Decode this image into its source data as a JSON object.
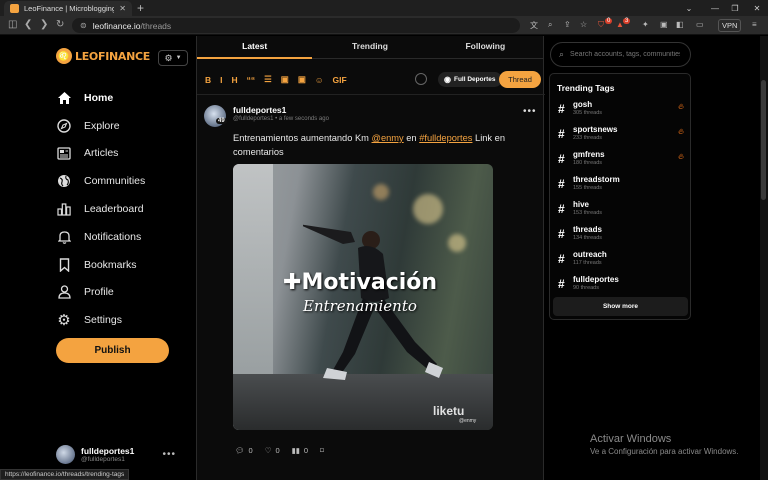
{
  "browser": {
    "tab_title": "LeoFinance | Microblogging in Bl...",
    "url_host": "leofinance.io",
    "url_path": "/threads",
    "vpn_label": "VPN",
    "badge_count_1": "0",
    "badge_count_2": "3"
  },
  "sidebar": {
    "logo_text": "LEOFINANCE",
    "items": [
      {
        "label": "Home",
        "icon": "home-icon"
      },
      {
        "label": "Explore",
        "icon": "compass-icon"
      },
      {
        "label": "Articles",
        "icon": "newspaper-icon"
      },
      {
        "label": "Communities",
        "icon": "globe-icon"
      },
      {
        "label": "Leaderboard",
        "icon": "leaderboard-icon"
      },
      {
        "label": "Notifications",
        "icon": "bell-icon"
      },
      {
        "label": "Bookmarks",
        "icon": "bookmark-icon"
      },
      {
        "label": "Profile",
        "icon": "user-icon"
      },
      {
        "label": "Settings",
        "icon": "gear-icon"
      }
    ],
    "publish_label": "Publish",
    "account": {
      "name": "fulldeportes1",
      "handle": "@fulldeportes1"
    }
  },
  "feed": {
    "tabs": [
      "Latest",
      "Trending",
      "Following"
    ],
    "composer": {
      "toolbar": [
        "B",
        "I",
        "H",
        "““",
        "☰",
        "▣",
        "▣",
        "☺",
        "GIF"
      ],
      "community_label": "Full Deportes",
      "thread_button": "Thread"
    },
    "post": {
      "author": "fulldeportes1",
      "level": "49",
      "handle": "@fulldeportes1",
      "time": "a few seconds ago",
      "text_prefix": "Entrenamientos aumentando Km ",
      "mention": "@enmy",
      "text_middle": " en ",
      "hashtag": "#fulldeportes",
      "text_suffix": " Link en comentarios",
      "media": {
        "title": "Motivación",
        "subtitle": "Entrenamiento",
        "watermark": "liketu",
        "watermark_sub": "@enmy"
      },
      "stats": {
        "comments": "0",
        "likes": "0",
        "views": "0"
      }
    }
  },
  "right": {
    "search_placeholder": "Search accounts, tags, communities",
    "trending_title": "Trending Tags",
    "tags": [
      {
        "name": "gosh",
        "count": "305 threads",
        "hot": true
      },
      {
        "name": "sportsnews",
        "count": "233 threads",
        "hot": true
      },
      {
        "name": "gmfrens",
        "count": "180 threads",
        "hot": true
      },
      {
        "name": "threadstorm",
        "count": "155 threads",
        "hot": false
      },
      {
        "name": "hive",
        "count": "153 threads",
        "hot": false
      },
      {
        "name": "threads",
        "count": "134 threads",
        "hot": false
      },
      {
        "name": "outreach",
        "count": "117 threads",
        "hot": false
      },
      {
        "name": "fulldeportes",
        "count": "90 threads",
        "hot": false
      }
    ],
    "show_more": "Show more"
  },
  "status_url": "https://leofinance.io/threads/trending-tags",
  "windows_watermark": {
    "line1": "Activar Windows",
    "line2": "Ve a Configuración para activar Windows."
  },
  "colors": {
    "accent": "#f4a340",
    "background": "#000000",
    "fire": "#ff7a1a"
  }
}
